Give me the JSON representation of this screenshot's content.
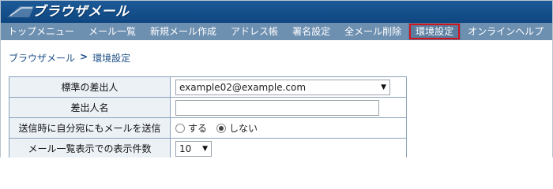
{
  "brand": {
    "title": "ブラウザメール",
    "logo_icon": "envelope-wing-logo"
  },
  "nav": {
    "items": [
      {
        "label": "トップメニュー"
      },
      {
        "label": "メール一覧"
      },
      {
        "label": "新規メール作成"
      },
      {
        "label": "アドレス帳"
      },
      {
        "label": "署名設定"
      },
      {
        "label": "全メール削除"
      },
      {
        "label": "環境設定",
        "active": true
      },
      {
        "label": "オンラインヘルプ"
      }
    ]
  },
  "breadcrumb": {
    "root": "ブラウザメール",
    "separator": ">",
    "current": "環境設定"
  },
  "settings": {
    "rows": {
      "default_sender": {
        "label": "標準の差出人",
        "value": "example02@example.com"
      },
      "sender_name": {
        "label": "差出人名",
        "value": ""
      },
      "send_copy": {
        "label": "送信時に自分宛にもメールを送信",
        "option_yes": "する",
        "option_no": "しない",
        "selected": "しない"
      },
      "list_count": {
        "label": "メール一覧表示での表示件数",
        "value": "10"
      }
    }
  },
  "colors": {
    "brand_bar": "#0e4680",
    "nav_bar": "#6d8fb0",
    "active_outline": "#d1141c",
    "label_bg": "#ecf1f6"
  }
}
